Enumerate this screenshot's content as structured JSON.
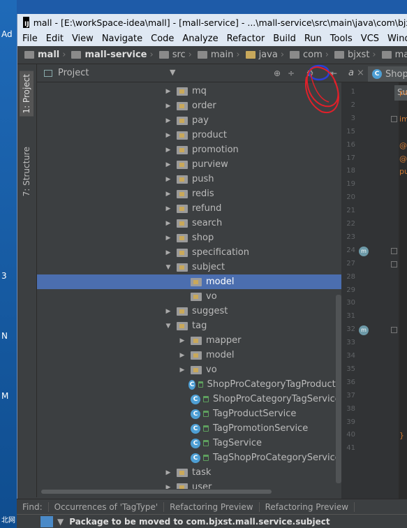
{
  "desktop": {
    "labels": [
      "Ad",
      "3",
      "N",
      "M",
      "北网"
    ]
  },
  "window": {
    "title": "mall - [E:\\workSpace-idea\\mall] - [mall-service] - ...\\mall-service\\src\\main\\java\\com\\bjxst\\mall",
    "app_icon": "IJ"
  },
  "menu": [
    "File",
    "Edit",
    "View",
    "Navigate",
    "Code",
    "Analyze",
    "Refactor",
    "Build",
    "Run",
    "Tools",
    "VCS",
    "Window"
  ],
  "breadcrumb": [
    "mall",
    "mall-service",
    "src",
    "main",
    "java",
    "com",
    "bjxst",
    "mall",
    "servi"
  ],
  "side_tabs": {
    "project": "1: Project",
    "structure": "7: Structure"
  },
  "project_panel": {
    "title": "Project"
  },
  "tree": [
    {
      "label": "mq",
      "depth": 0,
      "arrow": "right",
      "kind": "folder"
    },
    {
      "label": "order",
      "depth": 0,
      "arrow": "right",
      "kind": "folder"
    },
    {
      "label": "pay",
      "depth": 0,
      "arrow": "right",
      "kind": "folder"
    },
    {
      "label": "product",
      "depth": 0,
      "arrow": "right",
      "kind": "folder"
    },
    {
      "label": "promotion",
      "depth": 0,
      "arrow": "right",
      "kind": "folder"
    },
    {
      "label": "purview",
      "depth": 0,
      "arrow": "right",
      "kind": "folder"
    },
    {
      "label": "push",
      "depth": 0,
      "arrow": "right",
      "kind": "folder"
    },
    {
      "label": "redis",
      "depth": 0,
      "arrow": "right",
      "kind": "folder"
    },
    {
      "label": "refund",
      "depth": 0,
      "arrow": "right",
      "kind": "folder"
    },
    {
      "label": "search",
      "depth": 0,
      "arrow": "right",
      "kind": "folder"
    },
    {
      "label": "shop",
      "depth": 0,
      "arrow": "right",
      "kind": "folder"
    },
    {
      "label": "specification",
      "depth": 0,
      "arrow": "right",
      "kind": "folder"
    },
    {
      "label": "subject",
      "depth": 0,
      "arrow": "down",
      "kind": "folder"
    },
    {
      "label": "model",
      "depth": 1,
      "arrow": "none",
      "kind": "folder",
      "selected": true
    },
    {
      "label": "vo",
      "depth": 1,
      "arrow": "none",
      "kind": "folder"
    },
    {
      "label": "suggest",
      "depth": 0,
      "arrow": "right",
      "kind": "folder"
    },
    {
      "label": "tag",
      "depth": 0,
      "arrow": "down",
      "kind": "folder"
    },
    {
      "label": "mapper",
      "depth": 1,
      "arrow": "right",
      "kind": "folder"
    },
    {
      "label": "model",
      "depth": 1,
      "arrow": "right",
      "kind": "folder"
    },
    {
      "label": "vo",
      "depth": 1,
      "arrow": "right",
      "kind": "folder"
    },
    {
      "label": "ShopProCategoryTagProductS",
      "depth": 1,
      "arrow": "none",
      "kind": "class"
    },
    {
      "label": "ShopProCategoryTagService",
      "depth": 1,
      "arrow": "none",
      "kind": "class"
    },
    {
      "label": "TagProductService",
      "depth": 1,
      "arrow": "none",
      "kind": "class"
    },
    {
      "label": "TagPromotionService",
      "depth": 1,
      "arrow": "none",
      "kind": "class"
    },
    {
      "label": "TagService",
      "depth": 1,
      "arrow": "none",
      "kind": "class"
    },
    {
      "label": "TagShopProCategoryService",
      "depth": 1,
      "arrow": "none",
      "kind": "class"
    },
    {
      "label": "task",
      "depth": 0,
      "arrow": "right",
      "kind": "folder"
    },
    {
      "label": "user",
      "depth": 0,
      "arrow": "right",
      "kind": "folder"
    }
  ],
  "editor": {
    "tab1": "a",
    "tab2": "ShopC",
    "sub_tab": "Su",
    "lines": [
      {
        "n": "1",
        "code": "pa"
      },
      {
        "n": "2",
        "code": ""
      },
      {
        "n": "3",
        "code": "im"
      },
      {
        "n": "15",
        "code": ""
      },
      {
        "n": "16",
        "code": "@S"
      },
      {
        "n": "17",
        "code": "@M"
      },
      {
        "n": "18",
        "code": "pu"
      },
      {
        "n": "19",
        "code": ""
      },
      {
        "n": "20",
        "code": ""
      },
      {
        "n": "21",
        "code": ""
      },
      {
        "n": "22",
        "code": ""
      },
      {
        "n": "23",
        "code": ""
      },
      {
        "n": "24",
        "code": ""
      },
      {
        "n": "27",
        "code": ""
      },
      {
        "n": "28",
        "code": ""
      },
      {
        "n": "29",
        "code": ""
      },
      {
        "n": "30",
        "code": ""
      },
      {
        "n": "31",
        "code": ""
      },
      {
        "n": "32",
        "code": ""
      },
      {
        "n": "33",
        "code": ""
      },
      {
        "n": "34",
        "code": ""
      },
      {
        "n": "35",
        "code": ""
      },
      {
        "n": "36",
        "code": ""
      },
      {
        "n": "37",
        "code": ""
      },
      {
        "n": "38",
        "code": ""
      },
      {
        "n": "39",
        "code": ""
      },
      {
        "n": "40",
        "code": "}"
      },
      {
        "n": "41",
        "code": ""
      }
    ]
  },
  "bottom_tabs": [
    "Find:",
    "Occurrences of 'TagType'",
    "Refactoring Preview",
    "Refactoring Preview"
  ],
  "status": {
    "message": "Package to be moved to com.bjxst.mall.service.subject"
  },
  "colors": {
    "selection": "#4b6eaf",
    "annotation_red": "#e0202a",
    "annotation_blue": "#2a3fd6"
  }
}
